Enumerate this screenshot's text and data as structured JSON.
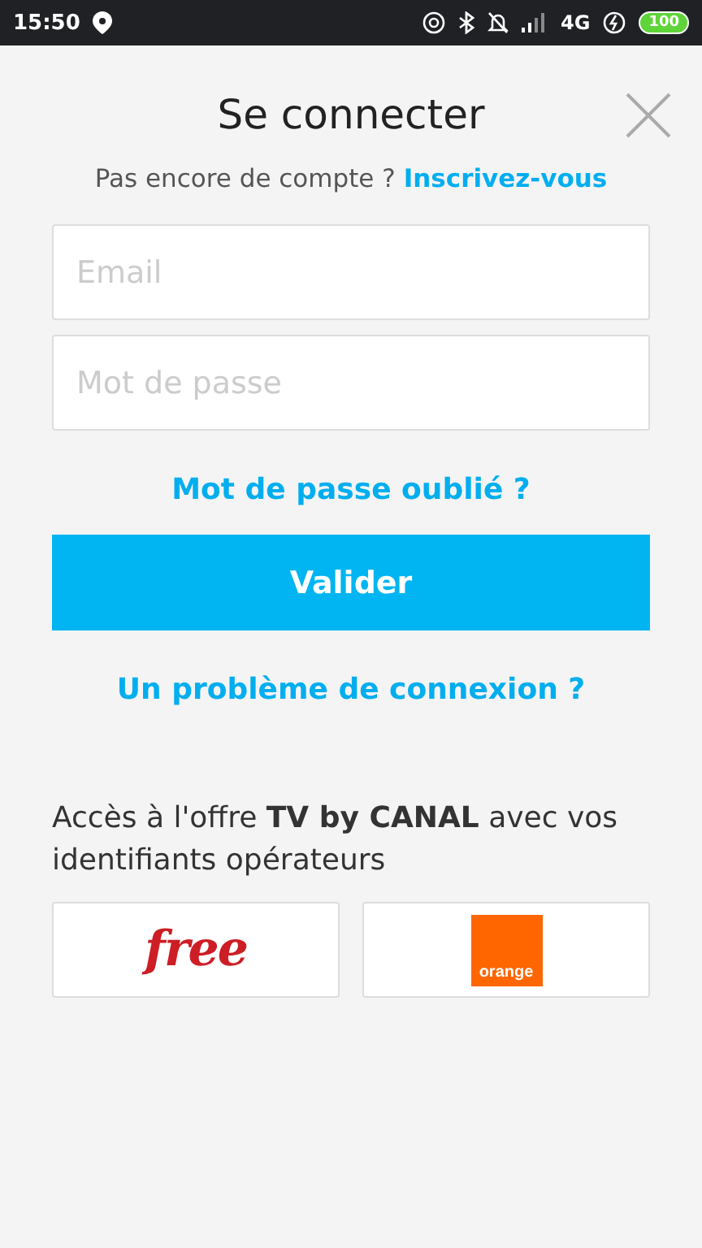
{
  "status_bar": {
    "time": "15:50",
    "network": "4G",
    "battery": "100"
  },
  "title": "Se connecter",
  "signup": {
    "text": "Pas encore de compte ?",
    "link": "Inscrivez-vous"
  },
  "fields": [
    {
      "placeholder": "Email"
    },
    {
      "placeholder": "Mot de passe"
    }
  ],
  "forgot_link": "Mot de passe oublié ?",
  "submit": "Valider",
  "problem_link": "Un problème de connexion ?",
  "operator_text": "Accès à l'offre **TV by CANAL** avec vos identifiants opérateurs",
  "operators": [
    {
      "kind": "free",
      "label": "free"
    },
    {
      "kind": "orange",
      "label": "orange"
    }
  ]
}
